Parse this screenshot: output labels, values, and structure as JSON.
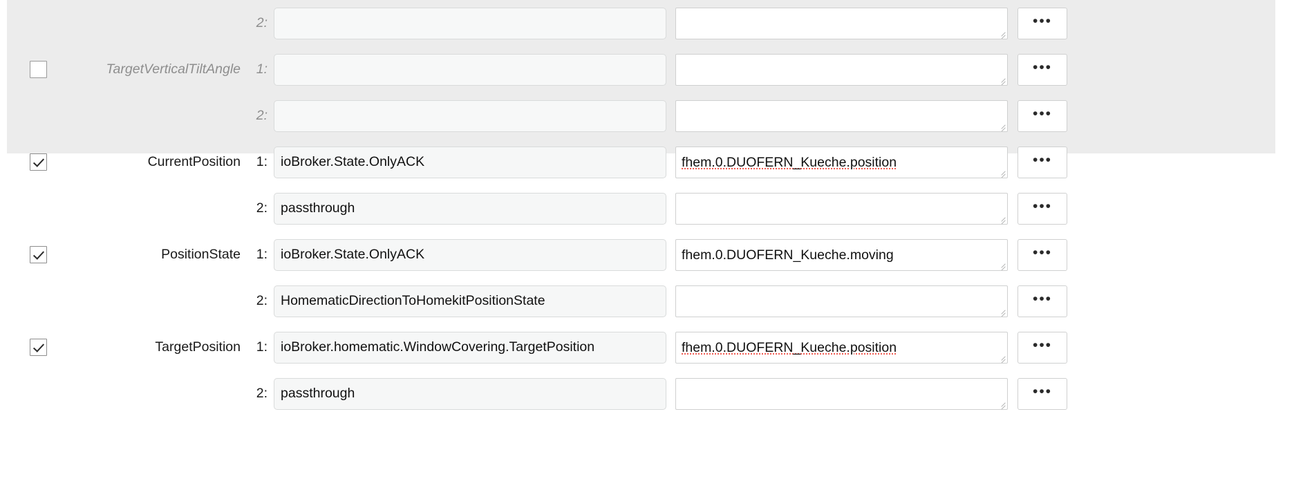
{
  "colors": {
    "shaded_row_bg": "#ececec",
    "page_bg": "#ffffff",
    "input_bg": "#f6f7f7",
    "input_border": "#d9dbdb",
    "textarea_bg": "#ffffff",
    "textarea_border": "#cfd0d0",
    "spellcheck_underline": "#f0594f",
    "text": "#1a1a1a",
    "muted_text": "#8e8e8e",
    "checkbox_border": "#8d8d8d"
  },
  "more_button_label": "•••",
  "rows": [
    {
      "id": "targetverticaltiltangle-line2-top",
      "disabled": true,
      "shaded": true,
      "show_checkbox": false,
      "checked": false,
      "name": "",
      "index": "2:",
      "value": "",
      "target": "",
      "spellcheck_error": false,
      "more_label": "•••"
    },
    {
      "id": "targetverticaltiltangle-line1",
      "disabled": true,
      "shaded": true,
      "show_checkbox": true,
      "checked": false,
      "name": "TargetVerticalTiltAngle",
      "index": "1:",
      "value": "",
      "target": "",
      "spellcheck_error": false,
      "more_label": "•••"
    },
    {
      "id": "targetverticaltiltangle-line2",
      "disabled": true,
      "shaded": true,
      "show_checkbox": false,
      "checked": false,
      "name": "",
      "index": "2:",
      "value": "",
      "target": "",
      "spellcheck_error": false,
      "more_label": "•••"
    },
    {
      "id": "currentposition-line1",
      "disabled": false,
      "shaded": false,
      "show_checkbox": true,
      "checked": true,
      "name": "CurrentPosition",
      "index": "1:",
      "value": "ioBroker.State.OnlyACK",
      "target": "fhem.0.DUOFERN_Kueche.position",
      "spellcheck_error": true,
      "more_label": "•••"
    },
    {
      "id": "currentposition-line2",
      "disabled": false,
      "shaded": false,
      "show_checkbox": false,
      "checked": false,
      "name": "",
      "index": "2:",
      "value": "passthrough",
      "target": "",
      "spellcheck_error": false,
      "more_label": "•••"
    },
    {
      "id": "positionstate-line1",
      "disabled": false,
      "shaded": false,
      "show_checkbox": true,
      "checked": true,
      "name": "PositionState",
      "index": "1:",
      "value": "ioBroker.State.OnlyACK",
      "target": "fhem.0.DUOFERN_Kueche.moving",
      "spellcheck_error": false,
      "more_label": "•••"
    },
    {
      "id": "positionstate-line2",
      "disabled": false,
      "shaded": false,
      "show_checkbox": false,
      "checked": false,
      "name": "",
      "index": "2:",
      "value": "HomematicDirectionToHomekitPositionState",
      "target": "",
      "spellcheck_error": false,
      "more_label": "•••"
    },
    {
      "id": "targetposition-line1",
      "disabled": false,
      "shaded": false,
      "show_checkbox": true,
      "checked": true,
      "name": "TargetPosition",
      "index": "1:",
      "value": "ioBroker.homematic.WindowCovering.TargetPosition",
      "target": "fhem.0.DUOFERN_Kueche.position",
      "spellcheck_error": true,
      "more_label": "•••"
    },
    {
      "id": "targetposition-line2",
      "disabled": false,
      "shaded": false,
      "show_checkbox": false,
      "checked": false,
      "name": "",
      "index": "2:",
      "value": "passthrough",
      "target": "",
      "spellcheck_error": false,
      "more_label": "•••"
    }
  ]
}
